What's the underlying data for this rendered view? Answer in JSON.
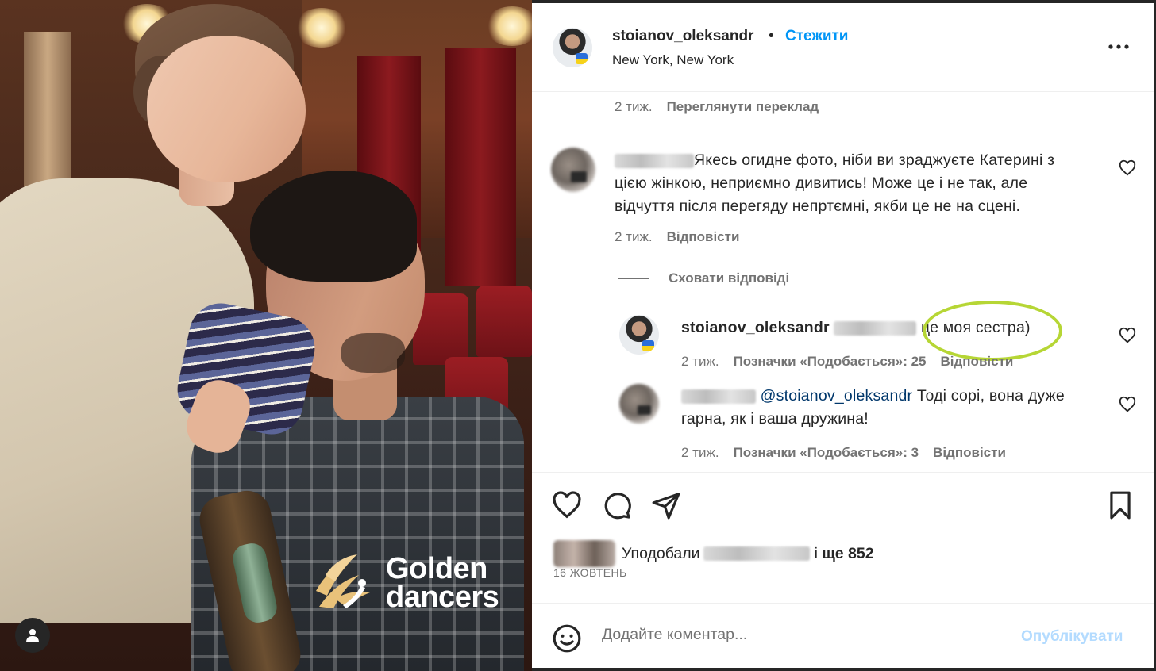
{
  "photo": {
    "brand_line1": "Golden",
    "brand_line2": "dancers"
  },
  "header": {
    "username": "stoianov_oleksandr",
    "dot": "•",
    "follow_label": "Стежити",
    "location": "New York, New York"
  },
  "comments": {
    "top_meta": {
      "time": "2 тиж.",
      "translate": "Переглянути переклад"
    },
    "c1": {
      "text_line1": "Якесь огидне фото, ніби ви зраджуєте Катерині з",
      "text_line2": "цією жінкою, неприємно дивитись! Може це і не так, але",
      "text_line3": "відчуття після перегяду непртємні, якби це не на сцені.",
      "time": "2 тиж.",
      "reply": "Відповісти"
    },
    "hide_replies": "Сховати відповіді",
    "r1": {
      "username": "stoianov_oleksandr",
      "text": "це моя сестра)",
      "time": "2 тиж.",
      "likes": "Позначки «Подобається»: 25",
      "reply": "Відповісти"
    },
    "r2": {
      "mention": "@stoianov_oleksandr",
      "text_line1": " Тоді сорі, вона дуже",
      "text_line2": "гарна, як і ваша дружина!",
      "time": "2 тиж.",
      "likes": "Позначки «Подобається»: 3",
      "reply": "Відповісти"
    }
  },
  "actions": {
    "liked_by": "Уподобали",
    "and": "і",
    "more": "ще 852",
    "date": "16 ЖОВТЕНЬ"
  },
  "composer": {
    "placeholder": "Додайте коментар...",
    "publish": "Опублікувати"
  },
  "colors": {
    "accent": "#0095f6",
    "link_disabled": "#b3dbff",
    "secondary_text": "#737373",
    "highlight_ring": "#b6d635"
  }
}
